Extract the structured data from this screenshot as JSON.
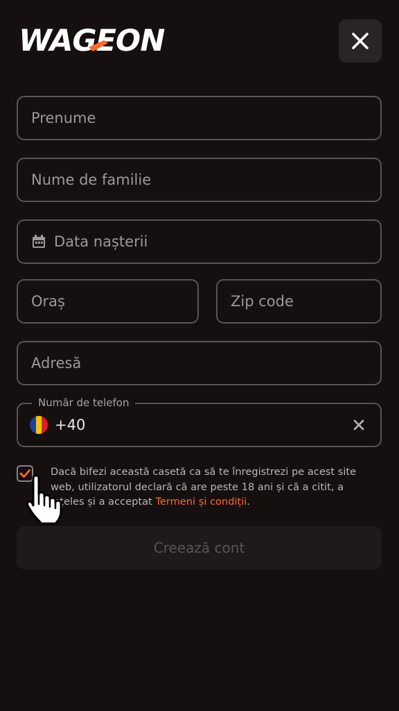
{
  "header": {
    "logo_text": "WAGEON",
    "close_icon": "close-icon"
  },
  "form": {
    "first_name_placeholder": "Prenume",
    "last_name_placeholder": "Nume de familie",
    "birth_date_placeholder": "Data nașterii",
    "city_placeholder": "Oraș",
    "zip_placeholder": "Zip code",
    "address_placeholder": "Adresă",
    "phone": {
      "label": "Număr de telefon",
      "country": "Romania",
      "flag_colors": [
        "#1d3f9e",
        "#f5c400",
        "#d91f2d"
      ],
      "code": "+40"
    }
  },
  "consent": {
    "checked": true,
    "text": "Dacă bifezi această casetă ca să te înregistrezi pe acest site web, utilizatorul declară că are peste 18 ani și că a citit, a înțeles și a acceptat ",
    "link_text": "Termeni și condiții",
    "suffix": "."
  },
  "actions": {
    "create_account_label": "Creează cont",
    "create_account_enabled": false
  },
  "colors": {
    "background": "#160f0f",
    "accent": "#ff6a2b",
    "border": "#5b5454"
  }
}
